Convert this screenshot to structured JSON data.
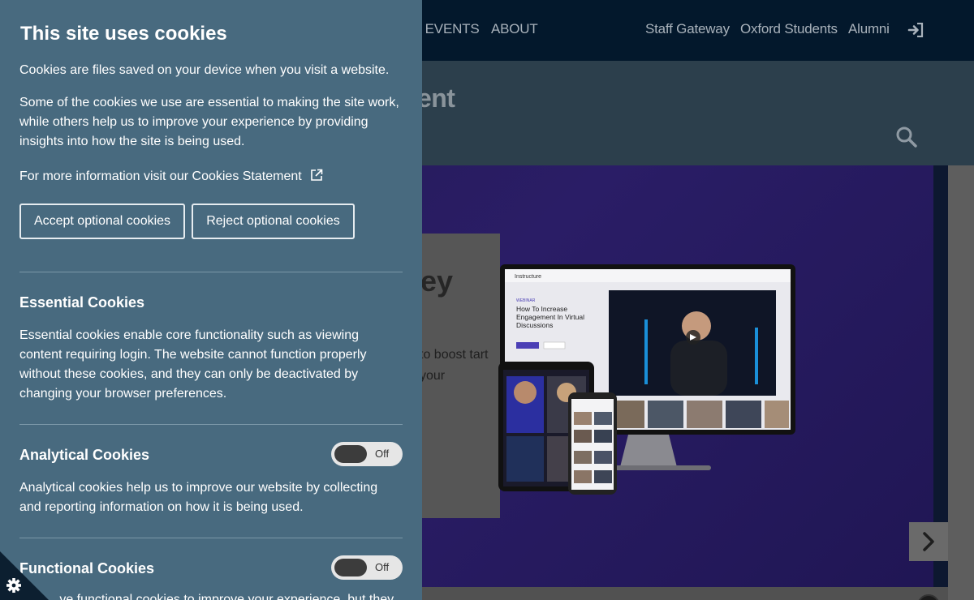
{
  "topnav": {
    "items": [
      "& EVENTS",
      "ABOUT",
      "Staff Gateway",
      "Oxford Students",
      "Alumni"
    ]
  },
  "subheader": {
    "title": "ment"
  },
  "hero": {
    "headline": "ey",
    "body": "to boost tart your",
    "device_screen": {
      "brand": "Instructure",
      "tag": "WEBINAR",
      "title": "How To Increase Engagement In Virtual Discussions"
    }
  },
  "cookie_panel": {
    "title": "This site uses cookies",
    "p1": "Cookies are files saved on your device when you visit a website.",
    "p2": "Some of the cookies we use are essential to making the site work, while others help us to improve your experience by providing insights into how the site is being used.",
    "more_info": "For more information visit our Cookies Statement",
    "accept_label": "Accept optional cookies",
    "reject_label": "Reject optional cookies",
    "essential": {
      "title": "Essential Cookies",
      "text": "Essential cookies enable core functionality such as viewing content requiring login. The website cannot function properly without these cookies, and they can only be deactivated by changing your browser preferences."
    },
    "analytical": {
      "title": "Analytical Cookies",
      "toggle_label": "Off",
      "text": "Analytical cookies help us to improve our website by collecting and reporting information on how it is being used."
    },
    "functional": {
      "title": "Functional Cookies",
      "toggle_label": "Off",
      "text": "...ve functional cookies to improve your experience, but they"
    }
  },
  "colors": {
    "panel_bg": "#486a7f",
    "topnav_bg": "#03182c",
    "hero_bg": "#2a1d66"
  }
}
